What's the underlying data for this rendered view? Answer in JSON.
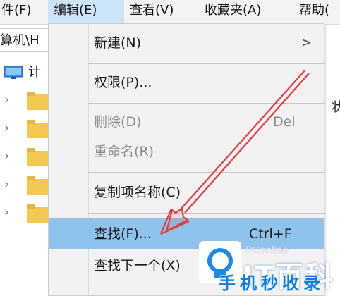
{
  "menubar": {
    "items": [
      {
        "label": "件(F)"
      },
      {
        "label": "编辑(E)"
      },
      {
        "label": "查看(V)"
      },
      {
        "label": "收藏夹(A)"
      },
      {
        "label": "帮助("
      }
    ]
  },
  "address": {
    "text": "算机\\H"
  },
  "tree": {
    "pc_label": "计",
    "right_edge_text": "状"
  },
  "menu": {
    "items": [
      {
        "label": "新建(N)",
        "shortcut": "",
        "submenu_arrow": ">",
        "state": "normal"
      },
      {
        "label": "权限(P)...",
        "shortcut": "",
        "state": "normal"
      },
      {
        "label": "删除(D)",
        "shortcut": "Del",
        "state": "disabled"
      },
      {
        "label": "重命名(R)",
        "shortcut": "",
        "state": "disabled"
      },
      {
        "label": "复制项名称(C)",
        "shortcut": "",
        "state": "normal"
      },
      {
        "label": "查找(F)...",
        "shortcut": "Ctrl+F",
        "state": "highlighted"
      },
      {
        "label": "查找下一个(X)",
        "shortcut": "",
        "state": "normal"
      }
    ]
  },
  "watermark": {
    "brand": "PConline",
    "site": "IT百科",
    "tagline": "手机秒收录"
  },
  "colors": {
    "highlight": "#8fc3ec",
    "menubar_active": "#cce4f7",
    "annotation_arrow": "#e63a3a",
    "folder": "#f5c752"
  }
}
